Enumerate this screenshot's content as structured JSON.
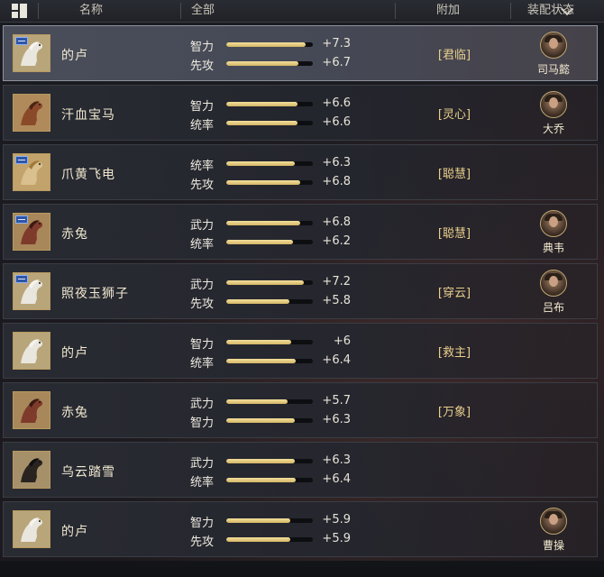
{
  "header": {
    "name_col": "名称",
    "filter_value": "全部",
    "bonus_col": "附加",
    "status_col": "装配状态"
  },
  "badge_label": "跨",
  "colors": {
    "bar_fill": "#e8cf83",
    "bonus_text": "#e9cf8c",
    "selected_border": "#8d929e"
  },
  "stat_max": 8,
  "mounts": [
    {
      "name": "的卢",
      "horse": "white",
      "badge": true,
      "selected": true,
      "stats": [
        {
          "label": "智力",
          "value": "+7.3"
        },
        {
          "label": "先攻",
          "value": "+6.7"
        }
      ],
      "bonus": "[君临]",
      "hero": "司马懿"
    },
    {
      "name": "汗血宝马",
      "horse": "brown",
      "badge": false,
      "selected": false,
      "stats": [
        {
          "label": "智力",
          "value": "+6.6"
        },
        {
          "label": "统率",
          "value": "+6.6"
        }
      ],
      "bonus": "[灵心]",
      "hero": "大乔"
    },
    {
      "name": "爪黄飞电",
      "horse": "gold",
      "badge": true,
      "selected": false,
      "stats": [
        {
          "label": "统率",
          "value": "+6.3"
        },
        {
          "label": "先攻",
          "value": "+6.8"
        }
      ],
      "bonus": "[聪慧]",
      "hero": ""
    },
    {
      "name": "赤兔",
      "horse": "red",
      "badge": true,
      "selected": false,
      "stats": [
        {
          "label": "武力",
          "value": "+6.8"
        },
        {
          "label": "统率",
          "value": "+6.2"
        }
      ],
      "bonus": "[聪慧]",
      "hero": "典韦"
    },
    {
      "name": "照夜玉狮子",
      "horse": "white",
      "badge": true,
      "selected": false,
      "stats": [
        {
          "label": "武力",
          "value": "+7.2"
        },
        {
          "label": "先攻",
          "value": "+5.8"
        }
      ],
      "bonus": "[穿云]",
      "hero": "吕布"
    },
    {
      "name": "的卢",
      "horse": "white",
      "badge": false,
      "selected": false,
      "stats": [
        {
          "label": "智力",
          "value": "+6"
        },
        {
          "label": "统率",
          "value": "+6.4"
        }
      ],
      "bonus": "[救主]",
      "hero": ""
    },
    {
      "name": "赤兔",
      "horse": "red",
      "badge": false,
      "selected": false,
      "stats": [
        {
          "label": "武力",
          "value": "+5.7"
        },
        {
          "label": "智力",
          "value": "+6.3"
        }
      ],
      "bonus": "[万象]",
      "hero": ""
    },
    {
      "name": "乌云踏雪",
      "horse": "black",
      "badge": false,
      "selected": false,
      "stats": [
        {
          "label": "武力",
          "value": "+6.3"
        },
        {
          "label": "统率",
          "value": "+6.4"
        }
      ],
      "bonus": "",
      "hero": ""
    },
    {
      "name": "的卢",
      "horse": "white",
      "badge": false,
      "selected": false,
      "stats": [
        {
          "label": "智力",
          "value": "+5.9"
        },
        {
          "label": "先攻",
          "value": "+5.9"
        }
      ],
      "bonus": "",
      "hero": "曹操"
    }
  ]
}
